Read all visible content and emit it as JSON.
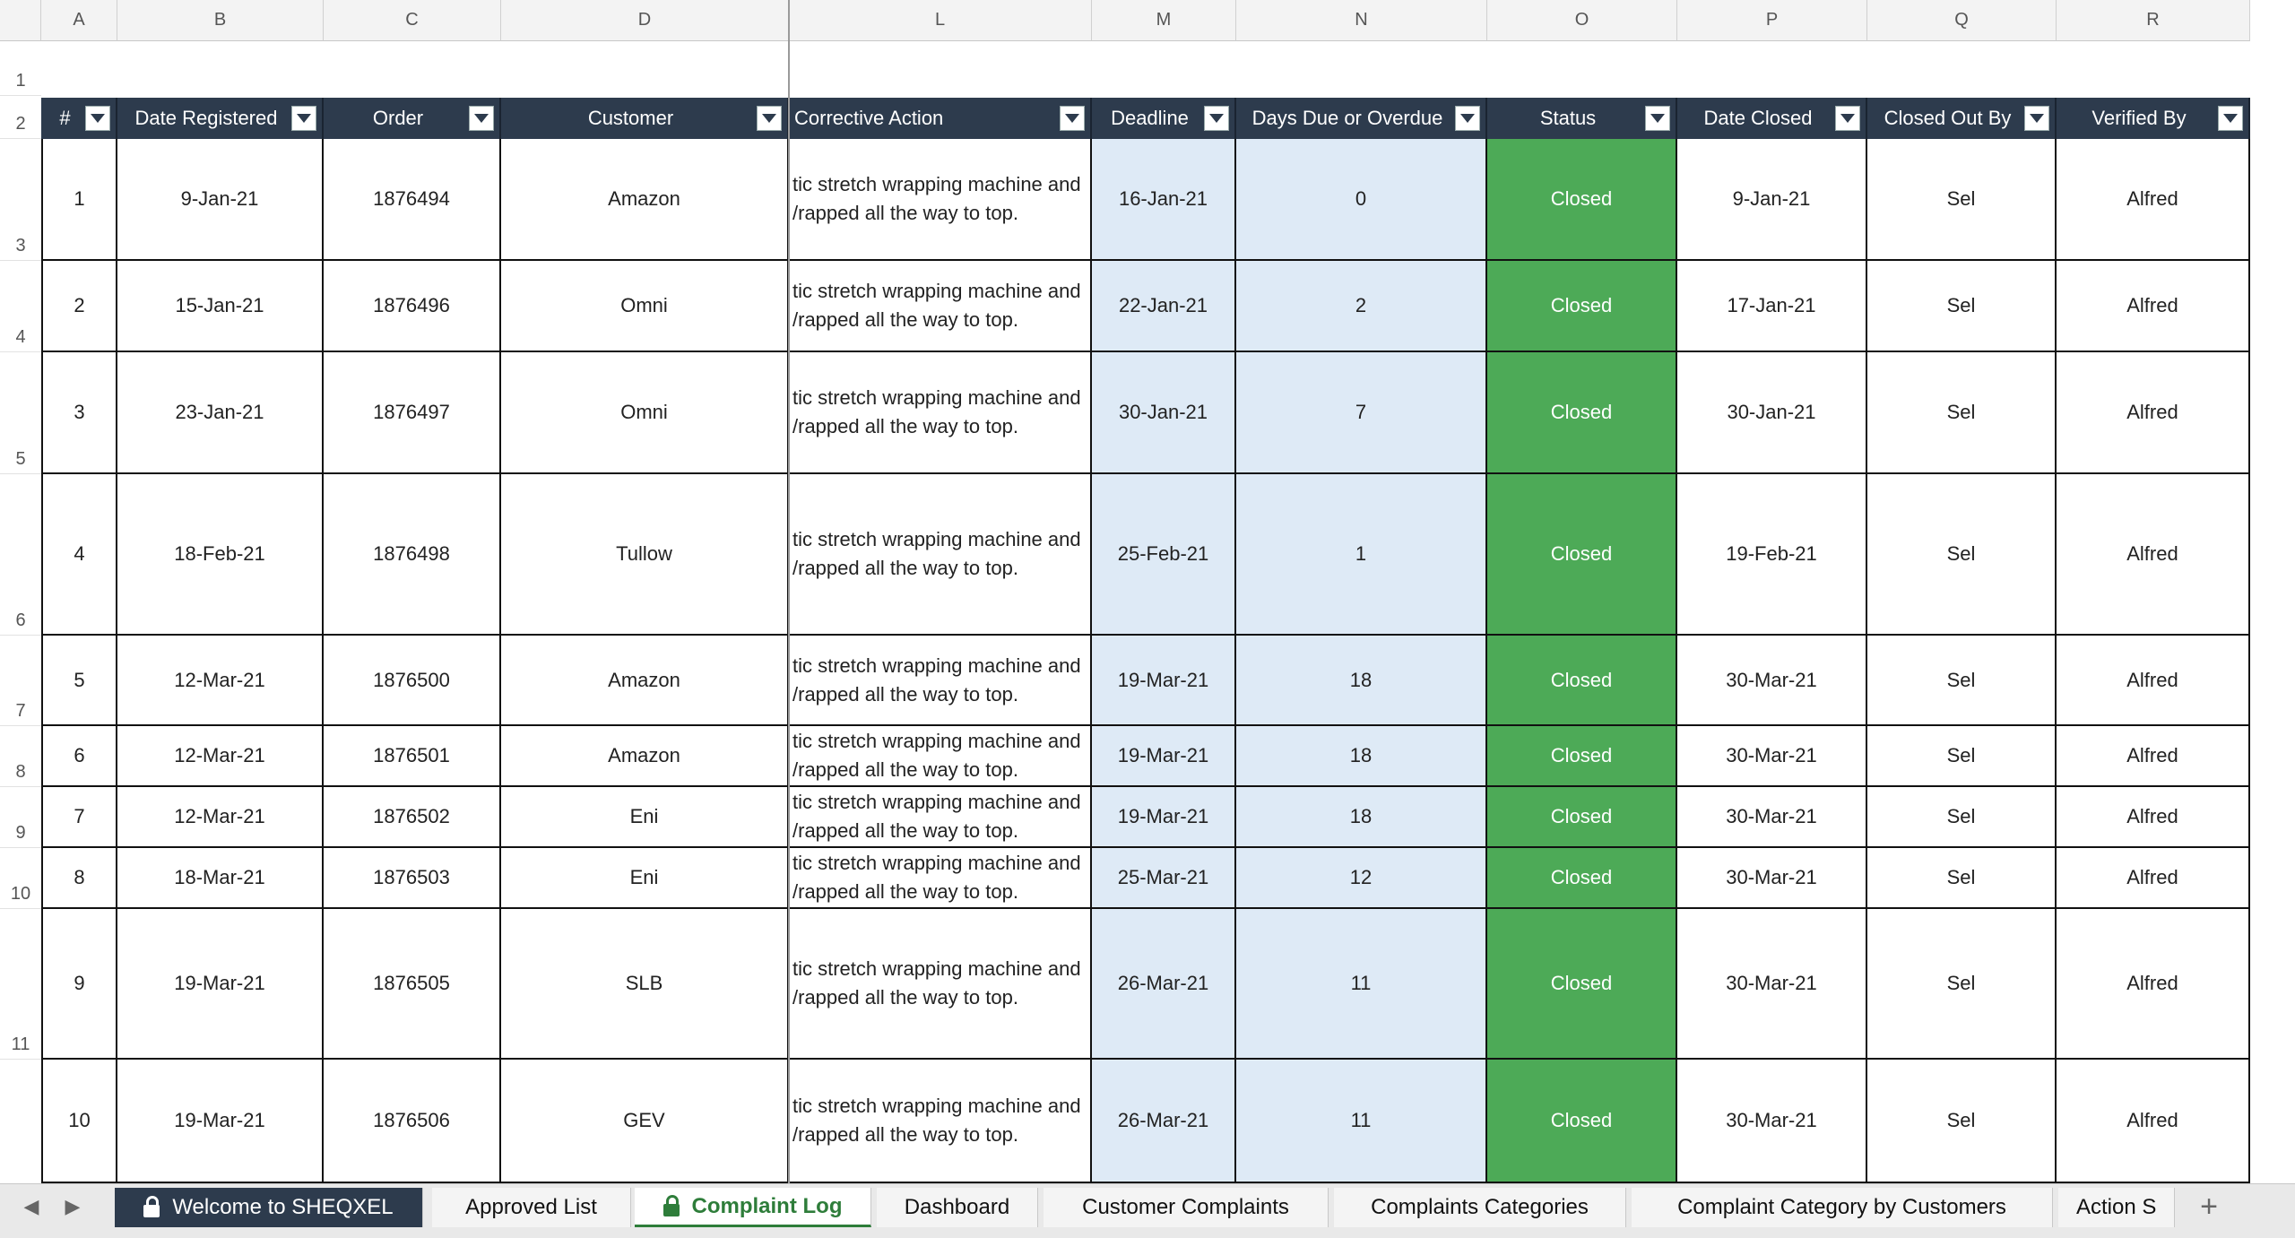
{
  "columns": [
    "A",
    "B",
    "C",
    "D",
    "L",
    "M",
    "N",
    "O",
    "P",
    "Q",
    "R"
  ],
  "row_numbers": [
    "1",
    "2",
    "3",
    "4",
    "5",
    "6",
    "7",
    "8",
    "9",
    "10",
    "11"
  ],
  "headers": [
    "#",
    "Date Registered",
    "Order",
    "Customer",
    "Corrective Action",
    "Deadline",
    "Days Due or Overdue",
    "Status",
    "Date Closed",
    "Closed Out By",
    "Verified By"
  ],
  "action_text": {
    "line1": "tic stretch wrapping machine and",
    "line2": "/rapped all the way to top."
  },
  "rows": [
    {
      "n": "1",
      "date": "9-Jan-21",
      "order": "1876494",
      "customer": "Amazon",
      "deadline": "16-Jan-21",
      "days": "0",
      "status": "Closed",
      "closed": "9-Jan-21",
      "by": "Sel",
      "verified": "Alfred"
    },
    {
      "n": "2",
      "date": "15-Jan-21",
      "order": "1876496",
      "customer": "Omni",
      "deadline": "22-Jan-21",
      "days": "2",
      "status": "Closed",
      "closed": "17-Jan-21",
      "by": "Sel",
      "verified": "Alfred"
    },
    {
      "n": "3",
      "date": "23-Jan-21",
      "order": "1876497",
      "customer": "Omni",
      "deadline": "30-Jan-21",
      "days": "7",
      "status": "Closed",
      "closed": "30-Jan-21",
      "by": "Sel",
      "verified": "Alfred"
    },
    {
      "n": "4",
      "date": "18-Feb-21",
      "order": "1876498",
      "customer": "Tullow",
      "deadline": "25-Feb-21",
      "days": "1",
      "status": "Closed",
      "closed": "19-Feb-21",
      "by": "Sel",
      "verified": "Alfred"
    },
    {
      "n": "5",
      "date": "12-Mar-21",
      "order": "1876500",
      "customer": "Amazon",
      "deadline": "19-Mar-21",
      "days": "18",
      "status": "Closed",
      "closed": "30-Mar-21",
      "by": "Sel",
      "verified": "Alfred"
    },
    {
      "n": "6",
      "date": "12-Mar-21",
      "order": "1876501",
      "customer": "Amazon",
      "deadline": "19-Mar-21",
      "days": "18",
      "status": "Closed",
      "closed": "30-Mar-21",
      "by": "Sel",
      "verified": "Alfred"
    },
    {
      "n": "7",
      "date": "12-Mar-21",
      "order": "1876502",
      "customer": "Eni",
      "deadline": "19-Mar-21",
      "days": "18",
      "status": "Closed",
      "closed": "30-Mar-21",
      "by": "Sel",
      "verified": "Alfred"
    },
    {
      "n": "8",
      "date": "18-Mar-21",
      "order": "1876503",
      "customer": "Eni",
      "deadline": "25-Mar-21",
      "days": "12",
      "status": "Closed",
      "closed": "30-Mar-21",
      "by": "Sel",
      "verified": "Alfred"
    },
    {
      "n": "9",
      "date": "19-Mar-21",
      "order": "1876505",
      "customer": "SLB",
      "deadline": "26-Mar-21",
      "days": "11",
      "status": "Closed",
      "closed": "30-Mar-21",
      "by": "Sel",
      "verified": "Alfred"
    },
    {
      "n": "10",
      "date": "19-Mar-21",
      "order": "1876506",
      "customer": "GEV",
      "deadline": "26-Mar-21",
      "days": "11",
      "status": "Closed",
      "closed": "30-Mar-21",
      "by": "Sel",
      "verified": "Alfred"
    }
  ],
  "tabs": [
    "Welcome to SHEQXEL",
    "Approved List",
    "Complaint Log",
    "Dashboard",
    "Customer Complaints",
    "Complaints Categories",
    "Complaint Category by Customers",
    "Action S"
  ],
  "colors": {
    "header_bg": "#2d3b4d",
    "status_closed": "#4daa57",
    "deadline_bg": "#deeaf6",
    "active_tab": "#2e7d3a"
  },
  "icons": {
    "lock": "lock-icon",
    "prev": "chevron-left-icon",
    "next": "chevron-right-icon",
    "add": "plus-icon",
    "filter": "filter-dropdown-icon"
  }
}
